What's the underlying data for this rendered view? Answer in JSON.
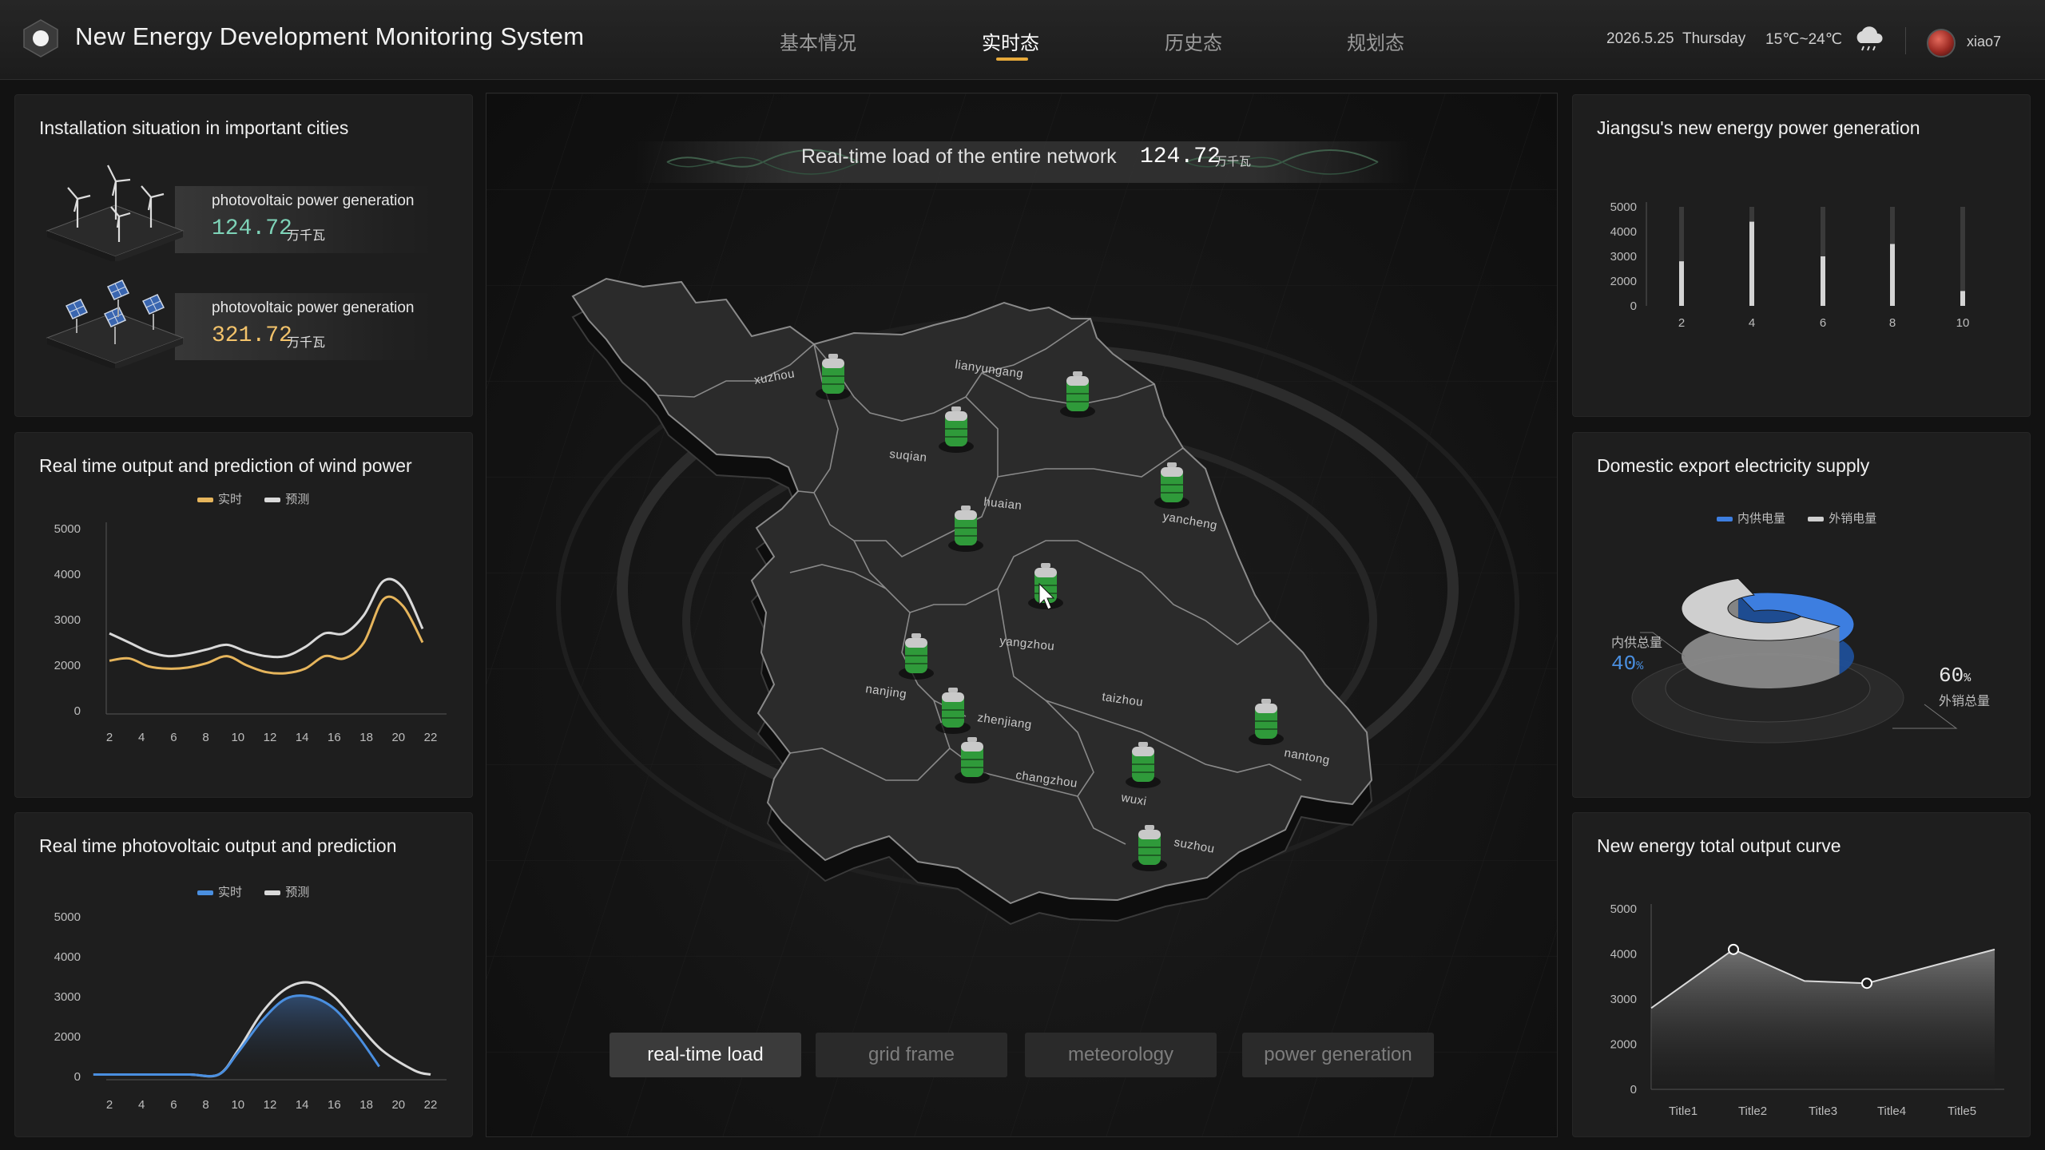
{
  "header": {
    "title": "New Energy Development Monitoring System",
    "tabs": [
      {
        "label": "基本情况"
      },
      {
        "label": "实时态"
      },
      {
        "label": "历史态"
      },
      {
        "label": "规划态"
      }
    ],
    "active_tab": "实时态",
    "date": "2026.5.25",
    "weekday": "Thursday",
    "temperature": "15℃~24℃",
    "username": "xiao7",
    "weather_icon": "cloud-rain-icon"
  },
  "installation": {
    "title": "Installation situation in important cities",
    "items": [
      {
        "label": "photovoltaic power generation",
        "value": "124.72",
        "unit": "万千瓦",
        "color": "#7ed3b8",
        "icon": "wind-turbine-icon"
      },
      {
        "label": "photovoltaic power generation",
        "value": "321.72",
        "unit": "万千瓦",
        "color": "#f3c36b",
        "icon": "solar-panel-icon"
      }
    ]
  },
  "wind_chart": {
    "title": "Real time output and prediction of wind power",
    "legend": [
      "实时",
      "预测"
    ],
    "colors": [
      "#e6b55c",
      "#d9d9d9"
    ]
  },
  "pv_chart": {
    "title": "Real time photovoltaic output and prediction",
    "legend": [
      "实时",
      "预测"
    ],
    "colors": [
      "#4a8fe0",
      "#d9d9d9"
    ]
  },
  "jiangsu_chart": {
    "title": "Jiangsu's new energy power generation"
  },
  "supply_chart": {
    "title": "Domestic export electricity supply",
    "legend": [
      "内供电量",
      "外销电量"
    ],
    "colors": [
      "#3d7ee0",
      "#cfcfcf"
    ],
    "left_label": "内供总量",
    "left_value": "40",
    "left_suffix": "%",
    "right_value": "60",
    "right_suffix": "%",
    "right_label": "外销总量"
  },
  "total_chart": {
    "title": "New energy total output curve"
  },
  "map": {
    "banner_text": "Real-time load of the entire network",
    "banner_value": "124.72",
    "banner_unit": "万千瓦",
    "cities": [
      "xuzhou",
      "lianyungang",
      "suqian",
      "huaian",
      "yancheng",
      "yangzhou",
      "nanjing",
      "zhenjiang",
      "taizhou",
      "nantong",
      "changzhou",
      "wuxi",
      "suzhou"
    ],
    "buttons": [
      {
        "label": "real-time load",
        "active": true
      },
      {
        "label": "grid frame",
        "active": false
      },
      {
        "label": "meteorology",
        "active": false
      },
      {
        "label": "power generation",
        "active": false
      }
    ]
  },
  "chart_data": [
    {
      "id": "wind",
      "type": "line",
      "title": "Real time output and prediction of wind power",
      "x": [
        1,
        2,
        3,
        4,
        5,
        6,
        7,
        8,
        9,
        10,
        11,
        12,
        13,
        14,
        15,
        16,
        17,
        18,
        19,
        20,
        21,
        22,
        23
      ],
      "xticks": [
        2,
        4,
        6,
        8,
        10,
        12,
        14,
        16,
        18,
        20,
        22
      ],
      "yticks": [
        0,
        2000,
        3000,
        4000,
        5000
      ],
      "series": [
        {
          "name": "实时",
          "values": [
            2100,
            2150,
            1950,
            1850,
            1900,
            2050,
            2200,
            2000,
            1700,
            1650,
            1850,
            2200,
            2150,
            2500,
            3450,
            3300,
            2500
          ]
        },
        {
          "name": "预测",
          "values": [
            2700,
            2500,
            2300,
            2200,
            2250,
            2350,
            2450,
            2300,
            2200,
            2200,
            2400,
            2700,
            2700,
            3100,
            3850,
            3700,
            2800
          ]
        }
      ]
    },
    {
      "id": "pv",
      "type": "area",
      "title": "Real time photovoltaic output and prediction",
      "xticks": [
        2,
        4,
        6,
        8,
        10,
        12,
        14,
        16,
        18,
        20,
        22
      ],
      "yticks": [
        0,
        2000,
        3000,
        4000,
        5000
      ],
      "series": [
        {
          "name": "实时",
          "x": [
            1,
            3,
            5,
            7,
            8.8,
            10,
            11.5,
            13,
            14.5,
            16,
            17.5,
            18.8
          ],
          "values": [
            100,
            100,
            100,
            100,
            100,
            1200,
            2400,
            2950,
            3000,
            2700,
            2000,
            500
          ]
        },
        {
          "name": "预测",
          "x": [
            1,
            3,
            5,
            7,
            8.8,
            10,
            11.5,
            13,
            14.5,
            16,
            17.5,
            19,
            21,
            22
          ],
          "values": [
            100,
            100,
            100,
            100,
            100,
            1300,
            2600,
            3200,
            3350,
            3000,
            2300,
            1300,
            300,
            100
          ]
        }
      ]
    },
    {
      "id": "jiangsu",
      "type": "bar",
      "title": "Jiangsu's new energy power generation",
      "categories": [
        "2",
        "4",
        "6",
        "8",
        "10"
      ],
      "values": [
        2800,
        4400,
        3000,
        3500,
        1200
      ],
      "ylim": [
        0,
        5000
      ],
      "yticks": [
        0,
        2000,
        3000,
        4000,
        5000
      ]
    },
    {
      "id": "supply",
      "type": "pie",
      "title": "Domestic export electricity supply",
      "categories": [
        "内供电量",
        "外销电量"
      ],
      "values": [
        40,
        60
      ]
    },
    {
      "id": "total",
      "type": "area",
      "title": "New energy total output curve",
      "categories": [
        "Title1",
        "Title2",
        "Title3",
        "Title4",
        "Title5"
      ],
      "values": [
        2800,
        4100,
        3400,
        3350,
        4100
      ],
      "yticks": [
        0,
        2000,
        3000,
        4000,
        5000
      ]
    }
  ]
}
